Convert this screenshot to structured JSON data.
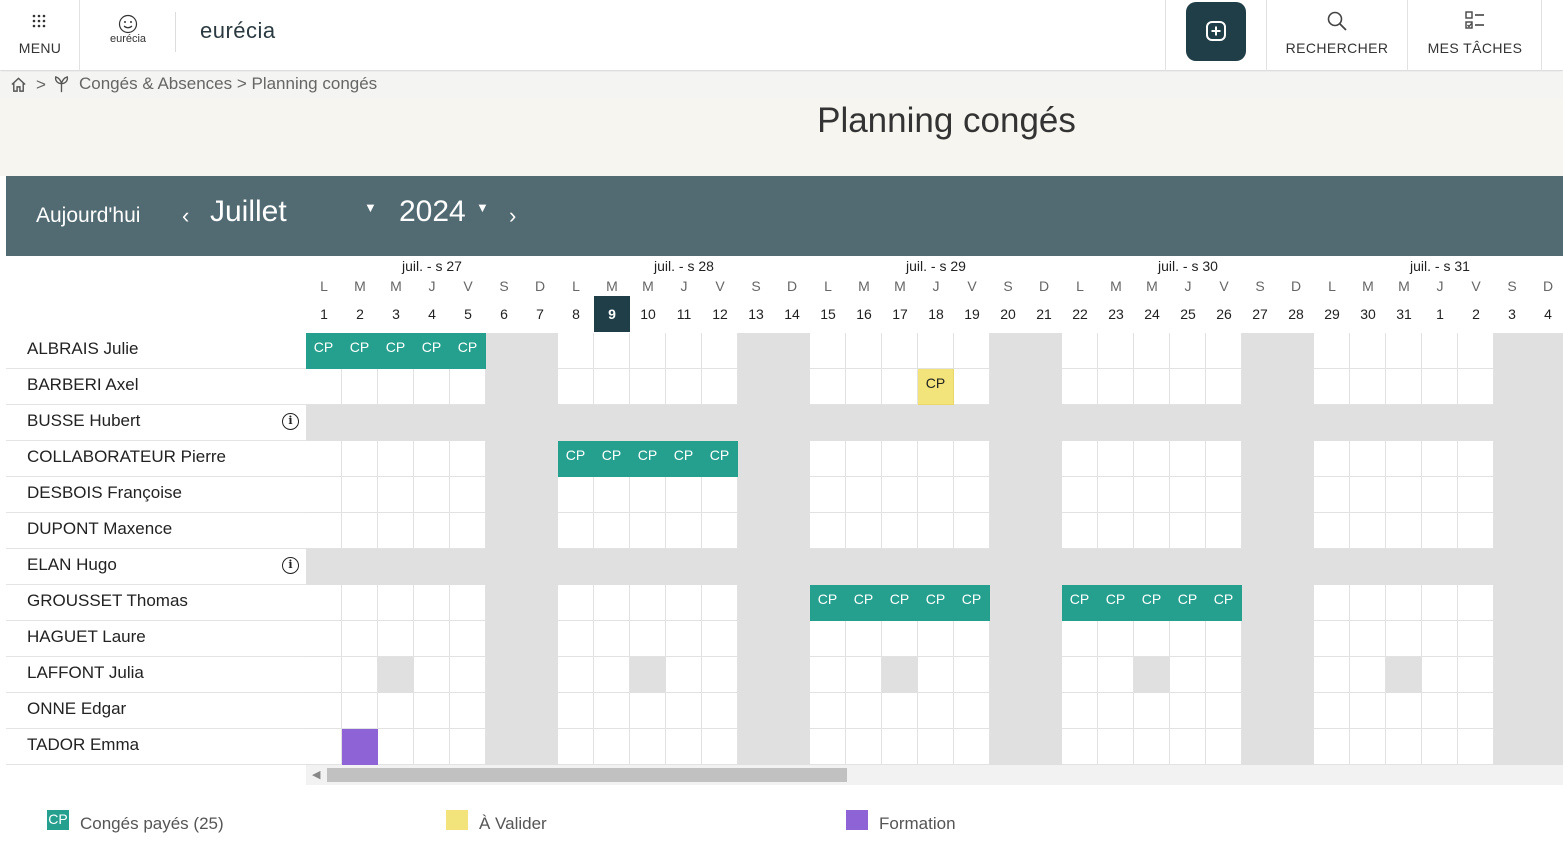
{
  "topbar": {
    "menu_label": "MENU",
    "logo_small_text": "eurécia",
    "logo_text": "eurécia",
    "search_label": "RECHERCHER",
    "tasks_label": "MES TÂCHES"
  },
  "breadcrumb": {
    "separator": ">",
    "text": "Congés & Absences > Planning congés"
  },
  "page_title": "Planning congés",
  "calendar_bar": {
    "today_label": "Aujourd'hui",
    "prev": "‹",
    "month": "Juillet",
    "year": "2024",
    "next": "›"
  },
  "weeks": [
    "juil. - s 27",
    "juil. - s 28",
    "juil. - s 29",
    "juil. - s 30",
    "juil. - s 31"
  ],
  "days": [
    {
      "l": "L",
      "n": "1"
    },
    {
      "l": "M",
      "n": "2"
    },
    {
      "l": "M",
      "n": "3"
    },
    {
      "l": "J",
      "n": "4"
    },
    {
      "l": "V",
      "n": "5"
    },
    {
      "l": "S",
      "n": "6"
    },
    {
      "l": "D",
      "n": "7"
    },
    {
      "l": "L",
      "n": "8"
    },
    {
      "l": "M",
      "n": "9"
    },
    {
      "l": "M",
      "n": "10"
    },
    {
      "l": "J",
      "n": "11"
    },
    {
      "l": "V",
      "n": "12"
    },
    {
      "l": "S",
      "n": "13"
    },
    {
      "l": "D",
      "n": "14"
    },
    {
      "l": "L",
      "n": "15"
    },
    {
      "l": "M",
      "n": "16"
    },
    {
      "l": "M",
      "n": "17"
    },
    {
      "l": "J",
      "n": "18"
    },
    {
      "l": "V",
      "n": "19"
    },
    {
      "l": "S",
      "n": "20"
    },
    {
      "l": "D",
      "n": "21"
    },
    {
      "l": "L",
      "n": "22"
    },
    {
      "l": "M",
      "n": "23"
    },
    {
      "l": "M",
      "n": "24"
    },
    {
      "l": "J",
      "n": "25"
    },
    {
      "l": "V",
      "n": "26"
    },
    {
      "l": "S",
      "n": "27"
    },
    {
      "l": "D",
      "n": "28"
    },
    {
      "l": "L",
      "n": "29"
    },
    {
      "l": "M",
      "n": "30"
    },
    {
      "l": "M",
      "n": "31"
    },
    {
      "l": "J",
      "n": "1"
    },
    {
      "l": "V",
      "n": "2"
    },
    {
      "l": "S",
      "n": "3"
    },
    {
      "l": "D",
      "n": "4"
    }
  ],
  "today_day": "9",
  "employees": [
    {
      "name": "ALBRAIS Julie",
      "info": false,
      "all_off": false,
      "cp": [
        1,
        2,
        3,
        4,
        5
      ],
      "va": [],
      "fo": [],
      "half": []
    },
    {
      "name": "BARBERI Axel",
      "info": false,
      "all_off": false,
      "cp": [],
      "va": [
        18
      ],
      "fo": [],
      "half": []
    },
    {
      "name": "BUSSE Hubert",
      "info": true,
      "all_off": true,
      "cp": [],
      "va": [],
      "fo": [],
      "half": []
    },
    {
      "name": "COLLABORATEUR Pierre",
      "info": false,
      "all_off": false,
      "cp": [
        8,
        9,
        10,
        11,
        12
      ],
      "va": [],
      "fo": [],
      "half": []
    },
    {
      "name": "DESBOIS Françoise",
      "info": false,
      "all_off": false,
      "cp": [],
      "va": [],
      "fo": [],
      "half": []
    },
    {
      "name": "DUPONT Maxence",
      "info": false,
      "all_off": false,
      "cp": [],
      "va": [],
      "fo": [],
      "half": []
    },
    {
      "name": "ELAN Hugo",
      "info": true,
      "all_off": true,
      "cp": [],
      "va": [],
      "fo": [],
      "half": []
    },
    {
      "name": "GROUSSET Thomas",
      "info": false,
      "all_off": false,
      "cp": [
        15,
        16,
        17,
        18,
        19,
        22,
        23,
        24,
        25,
        26
      ],
      "va": [],
      "fo": [],
      "half": []
    },
    {
      "name": "HAGUET Laure",
      "info": false,
      "all_off": false,
      "cp": [],
      "va": [],
      "fo": [],
      "half": []
    },
    {
      "name": "LAFFONT Julia",
      "info": false,
      "all_off": false,
      "cp": [],
      "va": [],
      "fo": [],
      "half": [
        3,
        10,
        17,
        24,
        31
      ]
    },
    {
      "name": "ONNE Edgar",
      "info": false,
      "all_off": false,
      "cp": [],
      "va": [],
      "fo": [],
      "half": []
    },
    {
      "name": "TADOR Emma",
      "info": false,
      "all_off": false,
      "cp": [],
      "va": [],
      "fo": [
        2
      ],
      "half": []
    }
  ],
  "cell_labels": {
    "cp": "CP",
    "va": "CP"
  },
  "info_glyph": "i",
  "legend": [
    {
      "swatch_text": "CP",
      "label": "Congés payés (25)",
      "color": "#26a08e"
    },
    {
      "swatch_text": "",
      "label": "À Valider",
      "color": "#f2e47a"
    },
    {
      "swatch_text": "",
      "label": "Formation",
      "color": "#8e63d6"
    }
  ],
  "colors": {
    "accent_dark": "#1f3e48",
    "bar_bg": "#526a72",
    "cp": "#26a08e",
    "to_validate": "#f2e47a",
    "training": "#8e63d6",
    "weekend": "#e0e0e0"
  }
}
